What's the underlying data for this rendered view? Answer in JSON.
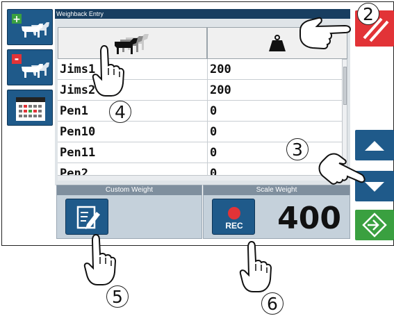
{
  "window": {
    "title": "Weighback Entry"
  },
  "sidebar": {
    "buttons": [
      {
        "name": "add-animal",
        "badge": "+"
      },
      {
        "name": "remove-animal",
        "badge": "-"
      },
      {
        "name": "calendar"
      }
    ]
  },
  "table": {
    "columns": [
      {
        "icon": "cattle-group-icon"
      },
      {
        "icon": "weight-icon"
      }
    ],
    "rows": [
      {
        "name": "Jims1",
        "weight": "200"
      },
      {
        "name": "Jims2",
        "weight": "200"
      },
      {
        "name": "Pen1",
        "weight": "0"
      },
      {
        "name": "Pen10",
        "weight": "0"
      },
      {
        "name": "Pen11",
        "weight": "0"
      },
      {
        "name": "Pen2",
        "weight": "0"
      }
    ]
  },
  "custom_weight": {
    "label": "Custom Weight",
    "icon": "edit-icon"
  },
  "scale_weight": {
    "label": "Scale Weight",
    "rec_label": "REC",
    "value": "400"
  },
  "right_buttons": [
    {
      "name": "cancel",
      "icon": "stripes-icon",
      "color": "#e23337"
    },
    {
      "name": "scroll-up",
      "icon": "triangle-up-icon",
      "color": "#1f5a8a"
    },
    {
      "name": "scroll-down",
      "icon": "triangle-down-icon",
      "color": "#1f5a8a"
    },
    {
      "name": "enter",
      "icon": "enter-arrow-icon",
      "color": "#3aa040"
    }
  ],
  "callouts": [
    "2",
    "3",
    "4",
    "5",
    "6"
  ]
}
